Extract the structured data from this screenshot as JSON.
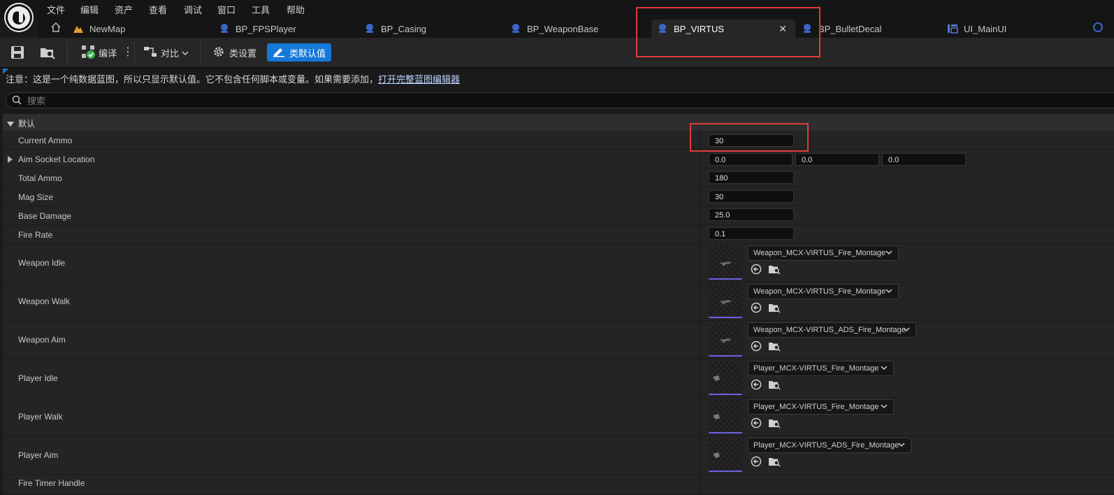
{
  "menu": [
    "文件",
    "编辑",
    "资产",
    "查看",
    "调试",
    "窗口",
    "工具",
    "帮助"
  ],
  "tabs": [
    {
      "label": "NewMap",
      "icon": "level-icon"
    },
    {
      "label": "BP_FPSPlayer",
      "icon": "blueprint-icon"
    },
    {
      "label": "BP_Casing",
      "icon": "blueprint-icon"
    },
    {
      "label": "BP_WeaponBase",
      "icon": "blueprint-icon"
    },
    {
      "label": "BP_VIRTUS",
      "icon": "blueprint-icon",
      "active": true
    },
    {
      "label": "BP_BulletDecal",
      "icon": "blueprint-icon"
    },
    {
      "label": "UI_MainUI",
      "icon": "widget-icon"
    }
  ],
  "toolbar": {
    "compile": "编译",
    "diff": "对比",
    "class_settings": "类设置",
    "class_defaults": "类默认值"
  },
  "note": {
    "text": "注意：这是一个纯数据蓝图，所以只显示默认值。它不包含任何脚本或变量。如果需要添加，",
    "link": "打开完整蓝图编辑器"
  },
  "search": {
    "placeholder": "搜索",
    "value": ""
  },
  "category": {
    "label": "默认"
  },
  "properties": [
    {
      "label": "Current Ammo",
      "value": "30"
    },
    {
      "label": "Aim Socket Location",
      "x": "0.0",
      "y": "0.0",
      "z": "0.0"
    },
    {
      "label": "Total Ammo",
      "value": "180"
    },
    {
      "label": "Mag Size",
      "value": "30"
    },
    {
      "label": "Base Damage",
      "value": "25.0"
    },
    {
      "label": "Fire Rate",
      "value": "0.1"
    },
    {
      "label": "Weapon Idle",
      "asset": "Weapon_MCX-VIRTUS_Fire_Montage"
    },
    {
      "label": "Weapon Walk",
      "asset": "Weapon_MCX-VIRTUS_Fire_Montage"
    },
    {
      "label": "Weapon Aim",
      "asset": "Weapon_MCX-VIRTUS_ADS_Fire_Montage"
    },
    {
      "label": "Player Idle",
      "asset": "Player_MCX-VIRTUS_Fire_Montage"
    },
    {
      "label": "Player Walk",
      "asset": "Player_MCX-VIRTUS_Fire_Montage"
    },
    {
      "label": "Player Aim",
      "asset": "Player_MCX-VIRTUS_ADS_Fire_Montage"
    },
    {
      "label": "Fire Timer Handle"
    }
  ],
  "colors": {
    "accent": "#1578d8",
    "highlight": "#e23b3b",
    "asset_underline": "#6b63e6"
  }
}
